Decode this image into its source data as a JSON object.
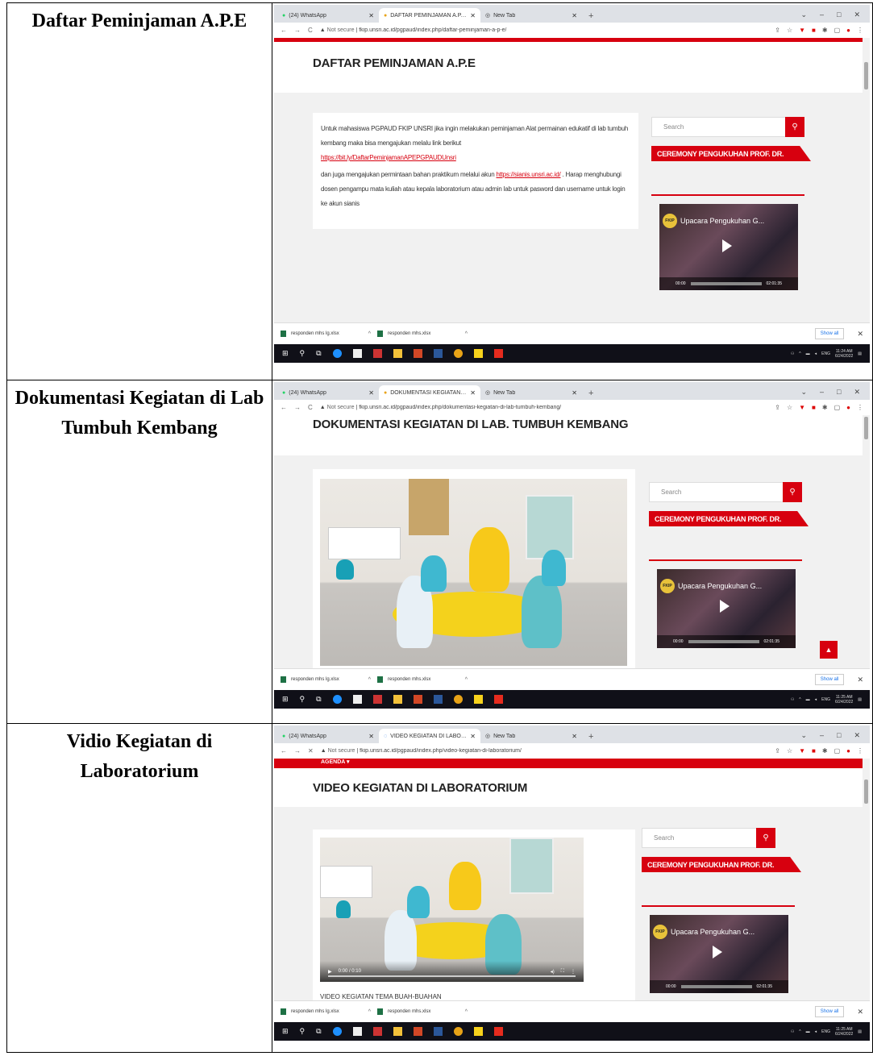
{
  "rows": [
    {
      "label": "Daftar Peminjaman A.P.E",
      "tabs": [
        "(24) WhatsApp",
        "DAFTAR PEMINJAMAN A.P.E – FI",
        "New Tab"
      ],
      "url_prefix": "Not secure",
      "url": "fkip.unsri.ac.id/pgpaud/index.php/daftar-peminjaman-a-p-e/",
      "page_title": "DAFTAR PEMINJAMAN A.P.E",
      "para1": "Untuk mahasiswa PGPAUD FKIP UNSRI jika ingin melakukan peminjaman Alat permainan edukatif di lab tumbuh kembang maka bisa mengajukan melalu link berikut",
      "link1": "https://bit.ly/DaftarPeminjamanAPEPGPAUDUnsri",
      "para2a": "dan juga mengajukan permintaan bahan praktikum melalui akun",
      "link2": "https://sianis.unsri.ac.id/",
      "para2b": ". Harap menghubungi dosen pengampu mata kuliah atau kepala laboratorium atau admin lab untuk pasword dan username untuk login ke akun sianis",
      "clock_time": "11:24 AM",
      "clock_date": "6/24/2022"
    },
    {
      "label": "Dokumentasi Kegiatan di Lab Tumbuh Kembang",
      "tabs": [
        "(24) WhatsApp",
        "DOKUMENTASI KEGIATAN DI LA",
        "New Tab"
      ],
      "url_prefix": "Not secure",
      "url": "fkip.unsri.ac.id/pgpaud/index.php/dokumentasi-kegiatan-di-lab-tumbuh-kembang/",
      "page_title": "DOKUMENTASI KEGIATAN DI LAB. TUMBUH KEMBANG",
      "clock_time": "11:25 AM",
      "clock_date": "6/24/2022"
    },
    {
      "label": "Vidio Kegiatan di Laboratorium",
      "tabs": [
        "(24) WhatsApp",
        "VIDEO KEGIATAN DI LABORATO",
        "New Tab"
      ],
      "url_prefix": "Not secure",
      "url": "fkip.unsri.ac.id/pgpaud/index.php/video-kegiatan-di-laboratorium/",
      "page_title": "VIDEO KEGIATAN DI LABORATORIUM",
      "agenda": "AGENDA",
      "video_time": "0:00 / 0:10",
      "caption": "VIDEO KEGIATAN TEMA BUAH-BUAHAN",
      "clock_time": "11:25 AM",
      "clock_date": "6/24/2022"
    }
  ],
  "sidebar": {
    "search_placeholder": "Search",
    "widget_title": "CEREMONY PENGUKUHAN PROF. DR.",
    "video_title": "Upacara Pengukuhan G...",
    "video_logo": "FKIP",
    "video_start": "00:00",
    "video_end": "02:01:35"
  },
  "downloads": {
    "file1": "responden mhs lg.xlsx",
    "file2": "responden mhs.xlsx",
    "show_all": "Show all"
  },
  "tray": {
    "lang": "ENG"
  },
  "colors": {
    "accent": "#d7000f",
    "chrome": "#dee1e6",
    "taskbar": "#101018"
  }
}
